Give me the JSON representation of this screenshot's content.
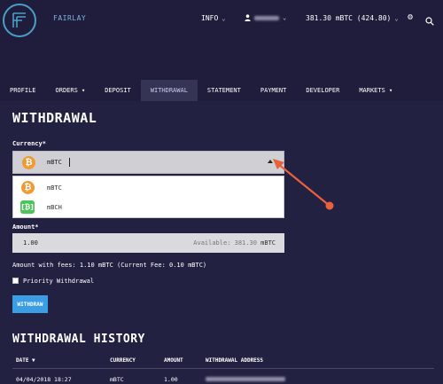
{
  "app": {
    "brand": "FAIRLAY"
  },
  "topnav": {
    "info_label": "INFO",
    "balance": "381.30 mBTC (424.80)"
  },
  "tabs": [
    {
      "label": "PROFILE",
      "dropdown": false,
      "active": false
    },
    {
      "label": "ORDERS",
      "dropdown": true,
      "active": false
    },
    {
      "label": "DEPOSIT",
      "dropdown": false,
      "active": false
    },
    {
      "label": "WITHDRAWAL",
      "dropdown": false,
      "active": true
    },
    {
      "label": "STATEMENT",
      "dropdown": false,
      "active": false
    },
    {
      "label": "PAYMENT",
      "dropdown": false,
      "active": false
    },
    {
      "label": "DEVELOPER",
      "dropdown": false,
      "active": false
    },
    {
      "label": "MARKETS",
      "dropdown": true,
      "active": false
    }
  ],
  "withdrawal": {
    "title": "WITHDRAWAL",
    "currency_label": "Currency*",
    "currency_value": "mBTC",
    "options": [
      {
        "label": "mBTC",
        "icon": "bitcoin-icon"
      },
      {
        "label": "mBCH",
        "icon": "bitcoin-cash-icon"
      }
    ],
    "amount_label": "Amount*",
    "amount_value": "1.00",
    "available_prefix": "Available: 381.30",
    "available_unit": "mBTC",
    "fees_text": "Amount with fees: 1.10 mBTC (Current Fee: 0.10 mBTC)",
    "priority_label": "Priority Withdrawal",
    "priority_checked": false,
    "button_label": "WITHDRAW"
  },
  "history": {
    "title": "WITHDRAWAL HISTORY",
    "columns": [
      "DATE ▼",
      "CURRENCY",
      "AMOUNT",
      "WITHDRAWAL ADDRESS"
    ],
    "rows": [
      {
        "date": "04/04/2018 18:27",
        "currency": "mBTC",
        "amount": "1.00"
      }
    ]
  },
  "colors": {
    "background": "#1f1d3b",
    "accent_blue": "#3b9de4",
    "annotation_arrow": "#e8603c"
  }
}
